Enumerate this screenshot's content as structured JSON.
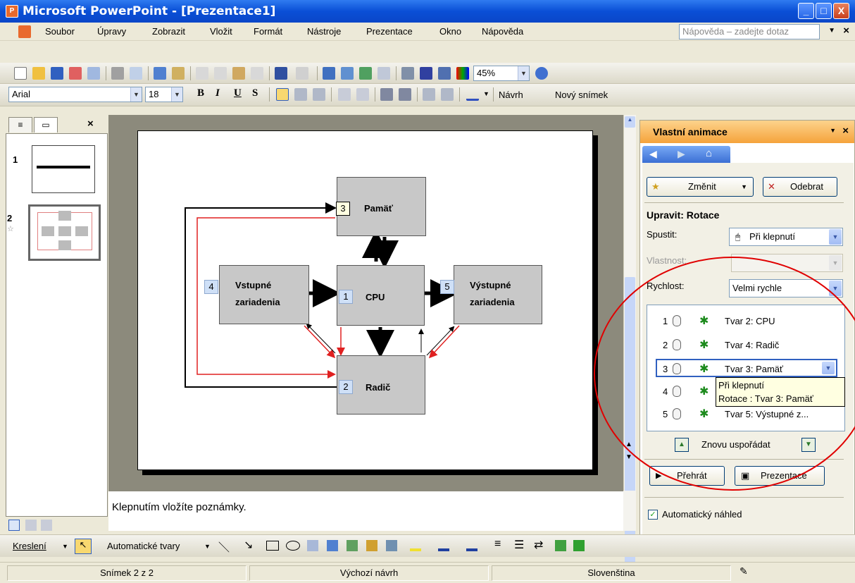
{
  "window": {
    "title": "Microsoft PowerPoint - [Prezentace1]",
    "app_icon": "powerpoint-icon",
    "controls": {
      "minimize": "_",
      "maximize": "□",
      "close": "X"
    }
  },
  "menu": {
    "items": [
      "Soubor",
      "Úpravy",
      "Zobrazit",
      "Vložit",
      "Formát",
      "Nástroje",
      "Prezentace",
      "Okno",
      "Nápověda"
    ],
    "help_placeholder": "Nápověda – zadejte dotaz",
    "close": "×"
  },
  "standard_toolbar": {
    "zoom": "45%"
  },
  "formatting_toolbar": {
    "font": "Arial",
    "size": "18",
    "bold": "B",
    "italic": "I",
    "underline": "U",
    "shadow": "S",
    "design_label": "Návrh",
    "new_slide_label": "Nový snímek"
  },
  "outline_tabs": {
    "close": "×"
  },
  "slides": [
    {
      "number": "1"
    },
    {
      "number": "2"
    }
  ],
  "diagram": {
    "pamat": {
      "tag": "3",
      "label": "Pamäť"
    },
    "vstup": {
      "tag": "4",
      "label_1": "Vstupné",
      "label_2": "zariadenia"
    },
    "cpu": {
      "tag": "1",
      "label": "CPU"
    },
    "vystup": {
      "tag": "5",
      "label_1": "Výstupné",
      "label_2": "zariadenia"
    },
    "radic": {
      "tag": "2",
      "label": "Radič"
    }
  },
  "notes": {
    "placeholder": "Klepnutím vložíte poznámky."
  },
  "task_pane": {
    "title": "Vlastní animace",
    "change_label": "Změnit",
    "remove_label": "Odebrat",
    "edit_heading": "Upravit: Rotace",
    "start_label": "Spustit:",
    "start_value": "Při klepnutí",
    "property_label": "Vlastnost:",
    "speed_label": "Rychlost:",
    "speed_value": "Velmi rychle",
    "animations": [
      {
        "num": "1",
        "label": "Tvar 2: CPU"
      },
      {
        "num": "2",
        "label": "Tvar 4: Radič"
      },
      {
        "num": "3",
        "label": "Tvar 3: Pamäť"
      },
      {
        "num": "4",
        "label": ""
      },
      {
        "num": "5",
        "label": "Tvar 5: Výstupné z..."
      }
    ],
    "tooltip_line1": "Při klepnutí",
    "tooltip_line2": "Rotace : Tvar 3: Pamäť",
    "reorder_label": "Znovu uspořádat",
    "play_label": "Přehrát",
    "show_label": "Prezentace",
    "autopreview_label": "Automatický náhled"
  },
  "draw_toolbar": {
    "draw_label": "Kreslení",
    "autoshapes_label": "Automatické tvary"
  },
  "status": {
    "slide": "Snímek 2 z 2",
    "design": "Výchozí návrh",
    "language": "Slovenština"
  },
  "colors": {
    "title_bar": "#0a4fd6",
    "task_header": "#f5a33b",
    "annotation_circle": "#e00000",
    "arrow_red": "#e02020"
  }
}
